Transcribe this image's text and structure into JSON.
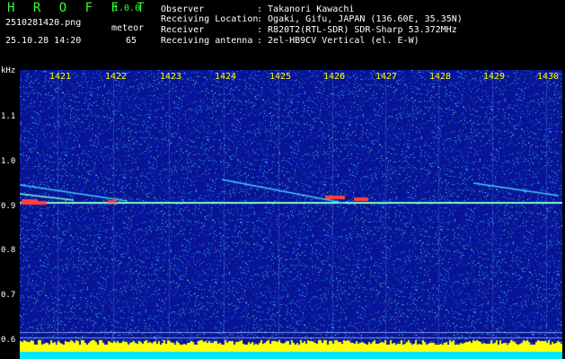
{
  "header": {
    "logo": "H R O F F T",
    "version": "1.0.0",
    "filename": "2510281420.png",
    "datetime": "25.10.28 14:20",
    "kind": "meteor",
    "count": "65"
  },
  "info": [
    {
      "label": "Observer",
      "value": ": Takanori Kawachi"
    },
    {
      "label": "Receiving Location",
      "value": ": Ogaki, Gifu, JAPAN (136.60E, 35.35N)"
    },
    {
      "label": "Receiver",
      "value": ": R820T2(RTL-SDR) SDR-Sharp 53.372MHz"
    },
    {
      "label": "Receiving antenna",
      "value": ": 2el-HB9CV Vertical (el. E-W)"
    }
  ],
  "axes": {
    "y_unit": "kHz",
    "x_ticks": [
      "1421",
      "1422",
      "1423",
      "1424",
      "1425",
      "1426",
      "1427",
      "1428",
      "1429",
      "1430"
    ],
    "y_ticks": [
      "1.1",
      "1.0",
      "0.9",
      "0.8",
      "0.7",
      "0.6"
    ]
  },
  "colors": {
    "background": "#000000",
    "noise_base": "#0a1c8c",
    "text": "#ffffff",
    "tick_label": "#ffff00",
    "logo": "#33ff33",
    "carrier": "#7fffd0",
    "meteor_hot": "#ff4040",
    "level_bar": "#ffff00",
    "level_base": "#00e5ff"
  }
}
